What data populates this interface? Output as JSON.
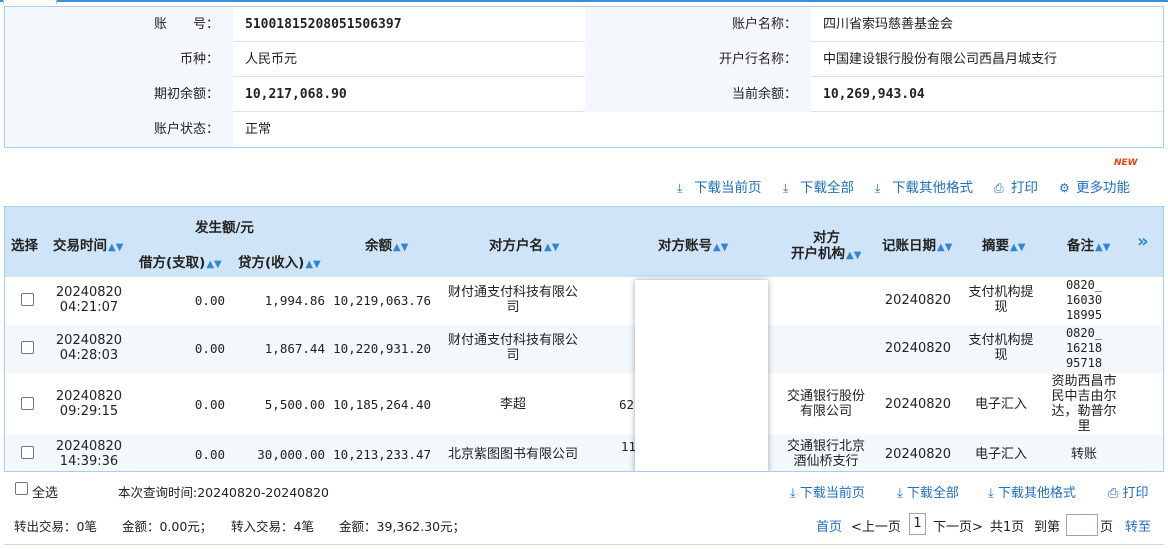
{
  "account": {
    "account_no_label": "账　　号：",
    "account_no": "51001815208051506397",
    "account_name_label": "账户名称：",
    "account_name": "四川省索玛慈善基金会",
    "currency_label": "币种：",
    "currency": "人民币元",
    "bank_label": "开户行名称：",
    "bank": "中国建设银行股份有限公司西昌月城支行",
    "opening_balance_label": "期初余额：",
    "opening_balance": "10,217,068.90",
    "current_balance_label": "当前余额：",
    "current_balance": "10,269,943.04",
    "status_label": "账户状态：",
    "status": "正常"
  },
  "toolbar": {
    "download_page": "下载当前页",
    "download_all": "下载全部",
    "download_other": "下载其他格式",
    "print": "打印",
    "more": "更多功能",
    "new_badge": "NEW"
  },
  "table": {
    "headers": {
      "select": "选择",
      "time": "交易时间",
      "amount_group": "发生额/元",
      "debit": "借方(支取)",
      "credit": "贷方(收入)",
      "balance": "余额",
      "counter_name": "对方户名",
      "counter_account": "对方账号",
      "counter_bank_1": "对方",
      "counter_bank_2": "开户机构",
      "book_date": "记账日期",
      "summary": "摘要",
      "remark": "备注",
      "more_cols": "»"
    },
    "rows": [
      {
        "date": "20240820",
        "time": "04:21:07",
        "debit": "0.00",
        "credit": "1,994.86",
        "balance": "10,219,063.76",
        "counter_name_1": "财付通支付科技有限公",
        "counter_name_2": "司",
        "counter_account": "",
        "bank_1": "",
        "bank_2": "",
        "book_date": "20240820",
        "summary_1": "支付机构提",
        "summary_2": "现",
        "remark_1": "0820_",
        "remark_2": "16030",
        "remark_3": "18995",
        "remark_4": ""
      },
      {
        "date": "20240820",
        "time": "04:28:03",
        "debit": "0.00",
        "credit": "1,867.44",
        "balance": "10,220,931.20",
        "counter_name_1": "财付通支付科技有限公",
        "counter_name_2": "司",
        "counter_account": "",
        "bank_1": "",
        "bank_2": "",
        "book_date": "20240820",
        "summary_1": "支付机构提",
        "summary_2": "现",
        "remark_1": "0820_",
        "remark_2": "16218",
        "remark_3": "95718",
        "remark_4": ""
      },
      {
        "date": "20240820",
        "time": "09:29:15",
        "debit": "0.00",
        "credit": "5,500.00",
        "balance": "10,185,264.40",
        "counter_name_1": "李超",
        "counter_name_2": "",
        "counter_account": "62",
        "bank_1": "交通银行股份",
        "bank_2": "有限公司",
        "book_date": "20240820",
        "summary_1": "电子汇入",
        "summary_2": "",
        "remark_1": "资助西昌市",
        "remark_2": "民中吉由尔",
        "remark_3": "达，勒普尔",
        "remark_4": "里"
      },
      {
        "date": "20240820",
        "time": "14:39:36",
        "debit": "0.00",
        "credit": "30,000.00",
        "balance": "10,213,233.47",
        "counter_name_1": "北京紫图图书有限公司",
        "counter_name_2": "",
        "counter_account": "11",
        "bank_1": "交通银行北京",
        "bank_2": "酒仙桥支行",
        "book_date": "20240820",
        "summary_1": "电子汇入",
        "summary_2": "",
        "remark_1": "转账",
        "remark_2": "",
        "remark_3": "",
        "remark_4": ""
      }
    ]
  },
  "footer": {
    "select_all": "全选",
    "query_time": "本次查询时间:20240820-20240820",
    "download_page": "下载当前页",
    "download_all": "下载全部",
    "download_other": "下载其他格式",
    "print": "打印",
    "out_summary": "转出交易：0笔　　金额：0.00元；　　转入交易：4笔　　金额：39,362.30元；",
    "first": "首页",
    "prev": "<上一页",
    "page_current": "1",
    "next": "下一页>",
    "total_pages": "共1页",
    "goto_label": "到第",
    "goto_value": "",
    "page_suffix": "页",
    "go": "转至"
  }
}
